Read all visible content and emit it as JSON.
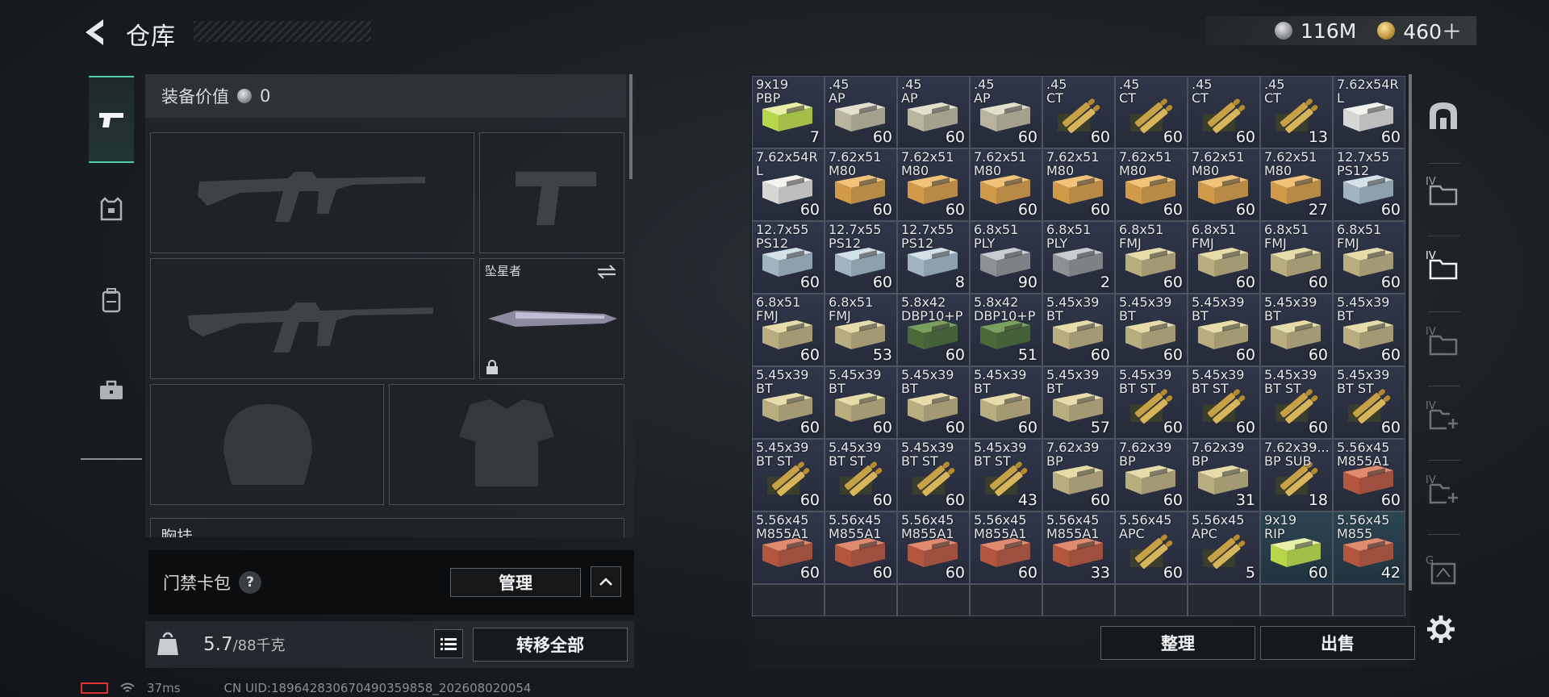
{
  "header": {
    "title": "仓库"
  },
  "currency": {
    "silver": "116M",
    "gold": "460＋"
  },
  "equipment": {
    "value_label": "装备价值",
    "value": "0",
    "melee_name": "坠星者",
    "chest_label": "胸挂"
  },
  "card_bar": {
    "label": "门禁卡包",
    "help": "?",
    "manage": "管理"
  },
  "weight": {
    "current": "5.7",
    "max": "/88千克"
  },
  "transfer_all": "转移全部",
  "status": {
    "ping": "37ms",
    "uid": "CN UID:189642830670490359858_202608020054"
  },
  "inventory": {
    "items": [
      {
        "name": "9x19\nPBP",
        "qty": "7",
        "kind": "green"
      },
      {
        "name": ".45\nAP",
        "qty": "60",
        "kind": "tan"
      },
      {
        "name": ".45\nAP",
        "qty": "60",
        "kind": "tan"
      },
      {
        "name": ".45\nAP",
        "qty": "60",
        "kind": "tan"
      },
      {
        "name": ".45\nCT",
        "qty": "60",
        "kind": "rounds"
      },
      {
        "name": ".45\nCT",
        "qty": "60",
        "kind": "rounds"
      },
      {
        "name": ".45\nCT",
        "qty": "60",
        "kind": "rounds"
      },
      {
        "name": ".45\nCT",
        "qty": "13",
        "kind": "rounds"
      },
      {
        "name": "7.62x54R\nL",
        "qty": "60",
        "kind": "white"
      },
      {
        "name": "7.62x54R\nL",
        "qty": "60",
        "kind": "white"
      },
      {
        "name": "7.62x51\nM80",
        "qty": "60",
        "kind": "orange"
      },
      {
        "name": "7.62x51\nM80",
        "qty": "60",
        "kind": "orange"
      },
      {
        "name": "7.62x51\nM80",
        "qty": "60",
        "kind": "orange"
      },
      {
        "name": "7.62x51\nM80",
        "qty": "60",
        "kind": "orange"
      },
      {
        "name": "7.62x51\nM80",
        "qty": "60",
        "kind": "orange"
      },
      {
        "name": "7.62x51\nM80",
        "qty": "60",
        "kind": "orange"
      },
      {
        "name": "7.62x51\nM80",
        "qty": "27",
        "kind": "orange"
      },
      {
        "name": "12.7x55\nPS12",
        "qty": "60",
        "kind": "blue"
      },
      {
        "name": "12.7x55\nPS12",
        "qty": "60",
        "kind": "blue"
      },
      {
        "name": "12.7x55\nPS12",
        "qty": "60",
        "kind": "blue"
      },
      {
        "name": "12.7x55\nPS12",
        "qty": "8",
        "kind": "blue"
      },
      {
        "name": "6.8x51\nPLY",
        "qty": "90",
        "kind": "silver"
      },
      {
        "name": "6.8x51\nPLY",
        "qty": "2",
        "kind": "silver"
      },
      {
        "name": "6.8x51\nFMJ",
        "qty": "60",
        "kind": "olive"
      },
      {
        "name": "6.8x51\nFMJ",
        "qty": "60",
        "kind": "olive"
      },
      {
        "name": "6.8x51\nFMJ",
        "qty": "60",
        "kind": "olive"
      },
      {
        "name": "6.8x51\nFMJ",
        "qty": "60",
        "kind": "olive"
      },
      {
        "name": "6.8x51\nFMJ",
        "qty": "60",
        "kind": "olive"
      },
      {
        "name": "6.8x51\nFMJ",
        "qty": "53",
        "kind": "olive"
      },
      {
        "name": "5.8x42\nDBP10+P",
        "qty": "60",
        "kind": "darkgreen"
      },
      {
        "name": "5.8x42\nDBP10+P",
        "qty": "51",
        "kind": "darkgreen"
      },
      {
        "name": "5.45x39\nBT",
        "qty": "60",
        "kind": "olive"
      },
      {
        "name": "5.45x39\nBT",
        "qty": "60",
        "kind": "olive"
      },
      {
        "name": "5.45x39\nBT",
        "qty": "60",
        "kind": "olive"
      },
      {
        "name": "5.45x39\nBT",
        "qty": "60",
        "kind": "olive"
      },
      {
        "name": "5.45x39\nBT",
        "qty": "60",
        "kind": "olive"
      },
      {
        "name": "5.45x39\nBT",
        "qty": "60",
        "kind": "olive"
      },
      {
        "name": "5.45x39\nBT",
        "qty": "60",
        "kind": "olive"
      },
      {
        "name": "5.45x39\nBT",
        "qty": "60",
        "kind": "olive"
      },
      {
        "name": "5.45x39\nBT",
        "qty": "60",
        "kind": "olive"
      },
      {
        "name": "5.45x39\nBT",
        "qty": "57",
        "kind": "olive"
      },
      {
        "name": "5.45x39\nBT ST",
        "qty": "60",
        "kind": "rounds"
      },
      {
        "name": "5.45x39\nBT ST",
        "qty": "60",
        "kind": "rounds"
      },
      {
        "name": "5.45x39\nBT ST",
        "qty": "60",
        "kind": "rounds"
      },
      {
        "name": "5.45x39\nBT ST",
        "qty": "60",
        "kind": "rounds"
      },
      {
        "name": "5.45x39\nBT ST",
        "qty": "60",
        "kind": "rounds"
      },
      {
        "name": "5.45x39\nBT ST",
        "qty": "60",
        "kind": "rounds"
      },
      {
        "name": "5.45x39\nBT ST",
        "qty": "60",
        "kind": "rounds"
      },
      {
        "name": "5.45x39\nBT ST",
        "qty": "43",
        "kind": "rounds"
      },
      {
        "name": "7.62x39\nBP",
        "qty": "60",
        "kind": "olive"
      },
      {
        "name": "7.62x39\nBP",
        "qty": "60",
        "kind": "olive"
      },
      {
        "name": "7.62x39\nBP",
        "qty": "31",
        "kind": "olive"
      },
      {
        "name": "7.62x39...\nBP SUB",
        "qty": "18",
        "kind": "rounds"
      },
      {
        "name": "5.56x45\nM855A1",
        "qty": "60",
        "kind": "red"
      },
      {
        "name": "5.56x45\nM855A1",
        "qty": "60",
        "kind": "red"
      },
      {
        "name": "5.56x45\nM855A1",
        "qty": "60",
        "kind": "red"
      },
      {
        "name": "5.56x45\nM855A1",
        "qty": "60",
        "kind": "red"
      },
      {
        "name": "5.56x45\nM855A1",
        "qty": "60",
        "kind": "red"
      },
      {
        "name": "5.56x45\nM855A1",
        "qty": "33",
        "kind": "red"
      },
      {
        "name": "5.56x45\nAPC",
        "qty": "60",
        "kind": "rounds"
      },
      {
        "name": "5.56x45\nAPC",
        "qty": "5",
        "kind": "rounds"
      },
      {
        "name": "9x19\nRIP",
        "qty": "60",
        "kind": "green",
        "hl": true
      },
      {
        "name": "5.56x45\nM855",
        "qty": "42",
        "kind": "red",
        "hl": true
      }
    ]
  },
  "actions": {
    "sort": "整理",
    "sell": "出售"
  },
  "right_tabs": [
    "IV",
    "IV",
    "IV",
    "IV",
    "IV",
    "G"
  ]
}
